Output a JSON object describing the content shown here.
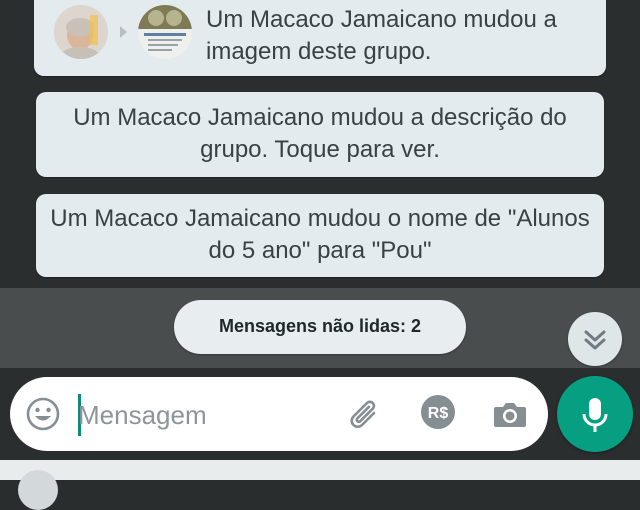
{
  "messages": [
    {
      "text": "Um Macaco Jamaicano mudou a imagem deste grupo."
    },
    {
      "text": "Um Macaco Jamaicano mudou a descrição do grupo. Toque para ver."
    },
    {
      "text": "Um Macaco Jamaicano mudou o nome de \"Alunos do 5 ano\" para \"Pou\""
    }
  ],
  "unread_banner": {
    "label": "Mensagens não lidas: 2"
  },
  "composer": {
    "placeholder": "Mensagem",
    "value": ""
  },
  "icons": {
    "emoji": "emoji-icon",
    "attach": "paperclip-icon",
    "payment": "rs-currency-icon",
    "camera": "camera-icon",
    "mic": "microphone-icon",
    "scroll_down": "double-chevron-down-icon"
  },
  "colors": {
    "accent": "#069f82",
    "bubble": "#e4ebee",
    "wallpaper": "#2b2e2f"
  }
}
